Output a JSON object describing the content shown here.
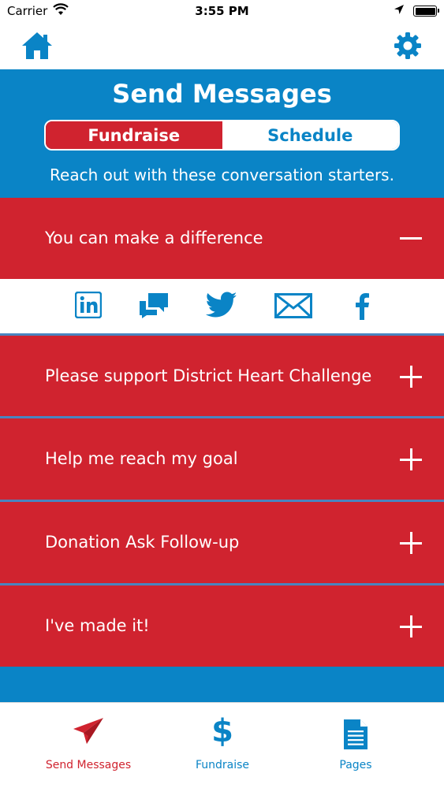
{
  "status_bar": {
    "carrier": "Carrier",
    "time": "3:55 PM"
  },
  "nav": {
    "home_icon": "home-icon",
    "settings_icon": "gear-icon"
  },
  "header": {
    "title": "Send Messages",
    "segments": [
      {
        "label": "Fundraise",
        "active": true
      },
      {
        "label": "Schedule",
        "active": false
      }
    ],
    "subtitle": "Reach out with these conversation starters."
  },
  "messages": [
    {
      "label": "You can make a difference",
      "expanded": true
    },
    {
      "label": "Please support District Heart Challenge",
      "expanded": false
    },
    {
      "label": "Help me reach my goal",
      "expanded": false
    },
    {
      "label": "Donation Ask Follow-up",
      "expanded": false
    },
    {
      "label": "I've made it!",
      "expanded": false
    }
  ],
  "share_icons": [
    "linkedin-icon",
    "chat-icon",
    "twitter-icon",
    "email-icon",
    "facebook-icon"
  ],
  "tabs": [
    {
      "label": "Send Messages",
      "icon": "paper-plane-icon",
      "active": true
    },
    {
      "label": "Fundraise",
      "icon": "dollar-icon",
      "active": false
    },
    {
      "label": "Pages",
      "icon": "document-icon",
      "active": false
    }
  ],
  "colors": {
    "brand_blue": "#0a84c6",
    "brand_red": "#d0232f",
    "divider": "#4a84bf"
  }
}
